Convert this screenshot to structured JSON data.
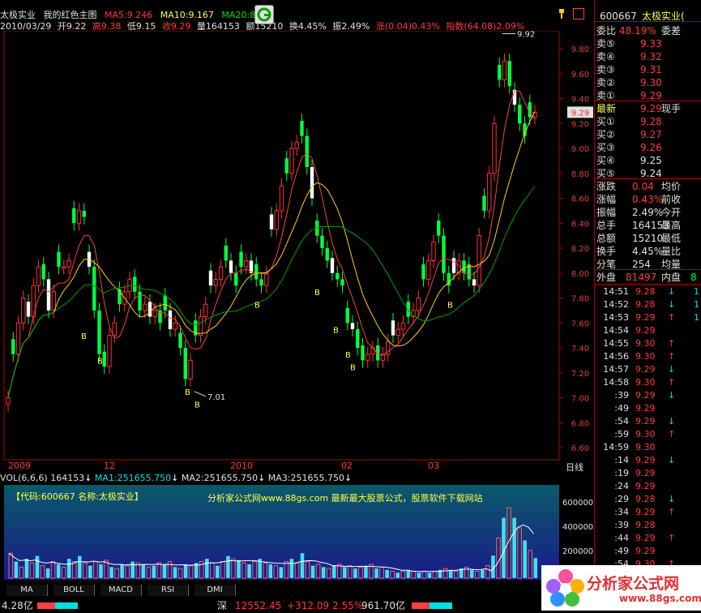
{
  "header": {
    "stock_name": "太极实业",
    "template": "我的红色主图",
    "ma5": "MA5:9.246",
    "ma10": "MA10:9.167",
    "ma20": "MA20:8",
    "date": "2010/03/29",
    "open": "开9.22",
    "high": "高9.38",
    "low": "低9.15",
    "close": "收9.29",
    "volume": "量164153",
    "amount": "额15210",
    "turnover": "换4.45%",
    "amplitude": "振2.49%",
    "change": "涨(0.04)0.43%",
    "index": "指数(64.08)2.09%"
  },
  "price_axis": [
    "9.80",
    "9.60",
    "9.40",
    "9.29",
    "9.20",
    "9.00",
    "8.80",
    "8.60",
    "8.40",
    "8.20",
    "8.00",
    "7.80",
    "7.60",
    "7.40",
    "7.20",
    "7.00",
    "6.80",
    "6.60"
  ],
  "annotations": {
    "high": "9.92",
    "low": "7.01",
    "buy_mark": "B"
  },
  "date_axis": {
    "d1": "2009",
    "d2": "12",
    "d3": "2010",
    "d4": "02",
    "d5": "03",
    "period": "日线"
  },
  "vol_header": {
    "vol": "VOL(6,6,6)",
    "vol_val": "164153",
    "ma1": "MA1:251655.750",
    "ma2": "MA2:251655.750",
    "ma3": "MA3:251655.750"
  },
  "vol_panel": {
    "code_text": "【代码:600667 名称:太极实业】",
    "site_text": "分析家公式网www.88gs.com 最新最大股票公式，股票软件下载网站",
    "axis": [
      "600000",
      "400000",
      "200000"
    ]
  },
  "tabs": [
    "MA",
    "BOLL",
    "MACD",
    "RSI",
    "DMI"
  ],
  "right_panel": {
    "code": "600667",
    "name": "太极实业(",
    "weibi_label": "委比",
    "weibi": "48.19%",
    "weicha_label": "委差",
    "sells": [
      {
        "label": "卖⑤",
        "price": "9.33"
      },
      {
        "label": "卖④",
        "price": "9.32"
      },
      {
        "label": "卖③",
        "price": "9.31"
      },
      {
        "label": "卖②",
        "price": "9.30"
      },
      {
        "label": "卖①",
        "price": "9.29"
      }
    ],
    "latest_label": "最新",
    "latest": "9.29",
    "xianshou_label": "现手",
    "buys": [
      {
        "label": "买①",
        "price": "9.28"
      },
      {
        "label": "买②",
        "price": "9.27"
      },
      {
        "label": "买③",
        "price": "9.26"
      },
      {
        "label": "买④",
        "price": "9.25"
      },
      {
        "label": "买⑤",
        "price": "9.24"
      }
    ],
    "stats": [
      {
        "l1": "涨跌",
        "v1": "0.04",
        "l2": "均价"
      },
      {
        "l1": "涨幅",
        "v1": "0.43%",
        "l2": "前收"
      },
      {
        "l1": "振幅",
        "v1": "2.49%",
        "l2": "今开"
      },
      {
        "l1": "总手",
        "v1": "164153",
        "l2": "最高"
      },
      {
        "l1": "总额",
        "v1": "15210",
        "l2": "最低"
      },
      {
        "l1": "换手",
        "v1": "4.45%",
        "l2": "量比"
      },
      {
        "l1": "分笔",
        "v1": "254",
        "l2": "均量"
      }
    ],
    "waipan_label": "外盘",
    "waipan": "81497",
    "neipan_label": "内盘",
    "neipan_val": "8",
    "ticks": [
      {
        "t": "14:51",
        "p": "9.28",
        "a": "↓",
        "x": "1"
      },
      {
        "t": "14:52",
        "p": "9.28",
        "a": "↓",
        "x": "1"
      },
      {
        "t": "14:53",
        "p": "9.29",
        "a": "↑",
        "x": "1"
      },
      {
        "t": "14:54",
        "p": "9.29",
        "a": "",
        "x": ""
      },
      {
        "t": "14:55",
        "p": "9.30",
        "a": "↑",
        "x": ""
      },
      {
        "t": "14:56",
        "p": "9.30",
        "a": "↑",
        "x": ""
      },
      {
        "t": "14:57",
        "p": "9.29",
        "a": "↓",
        "x": ""
      },
      {
        "t": "14:58",
        "p": "9.30",
        "a": "↑",
        "x": ""
      },
      {
        "t": ":39",
        "p": "9.29",
        "a": "↓",
        "x": ""
      },
      {
        "t": ":49",
        "p": "9.29",
        "a": "",
        "x": ""
      },
      {
        "t": ":54",
        "p": "9.29",
        "a": "↓",
        "x": ""
      },
      {
        "t": ":59",
        "p": "9.30",
        "a": "↑",
        "x": ""
      },
      {
        "t": "14:59",
        "p": "9.30",
        "a": "",
        "x": ""
      },
      {
        "t": ":14",
        "p": "9.29",
        "a": "↓",
        "x": ""
      },
      {
        "t": ":19",
        "p": "9.29",
        "a": "",
        "x": ""
      },
      {
        "t": ":24",
        "p": "9.29",
        "a": "",
        "x": ""
      },
      {
        "t": ":29",
        "p": "9.28",
        "a": "↓",
        "x": ""
      },
      {
        "t": ":34",
        "p": "9.29",
        "a": "↑",
        "x": ""
      },
      {
        "t": ":39",
        "p": "9.28",
        "a": "",
        "x": ""
      },
      {
        "t": ":44",
        "p": "9.29",
        "a": "↑",
        "x": ""
      },
      {
        "t": ":49",
        "p": "9.29",
        "a": "",
        "x": ""
      },
      {
        "t": ":54",
        "p": "9.30",
        "a": "↑",
        "x": ""
      },
      {
        "t": ":59",
        "p": "9.29",
        "a": "↓",
        "x": ""
      }
    ]
  },
  "status_bar": {
    "left_val": "4.28亿",
    "market": "深",
    "index_val": "12552.45",
    "index_chg": "+312.09",
    "index_pct": "2.55%",
    "amount": "961.70亿"
  },
  "logo": {
    "main": "分析家公式网",
    "url": "www.88gs.com"
  },
  "colors": {
    "up": "#ff3a3a",
    "down": "#00ff40",
    "bg": "#000000",
    "grid": "#b00000"
  }
}
